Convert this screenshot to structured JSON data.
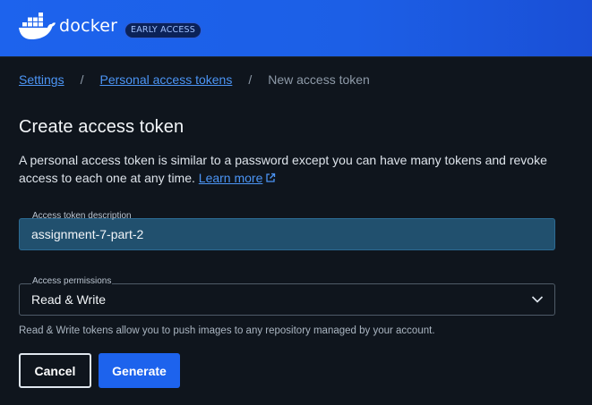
{
  "header": {
    "brand": "docker",
    "badge": "EARLY ACCESS",
    "logo_icon": "docker-whale-icon",
    "bar_color": "#1d63ed"
  },
  "breadcrumb": {
    "items": [
      "Settings",
      "Personal access tokens",
      "New access token"
    ],
    "separator": "/"
  },
  "page": {
    "title": "Create access token",
    "description": "A personal access token is similar to a password except you can have many tokens and revoke access to each one at any time.",
    "learn_more": "Learn more",
    "learn_more_icon": "external-link-icon"
  },
  "form": {
    "description_label": "Access token description",
    "description_value": "assignment-7-part-2",
    "permissions_label": "Access permissions",
    "permissions_value": "Read & Write",
    "permissions_icon": "chevron-down-icon",
    "permissions_helper": "Read & Write tokens allow you to push images to any repository managed by your account."
  },
  "actions": {
    "cancel_label": "Cancel",
    "generate_label": "Generate",
    "primary_color": "#1d63ed"
  }
}
